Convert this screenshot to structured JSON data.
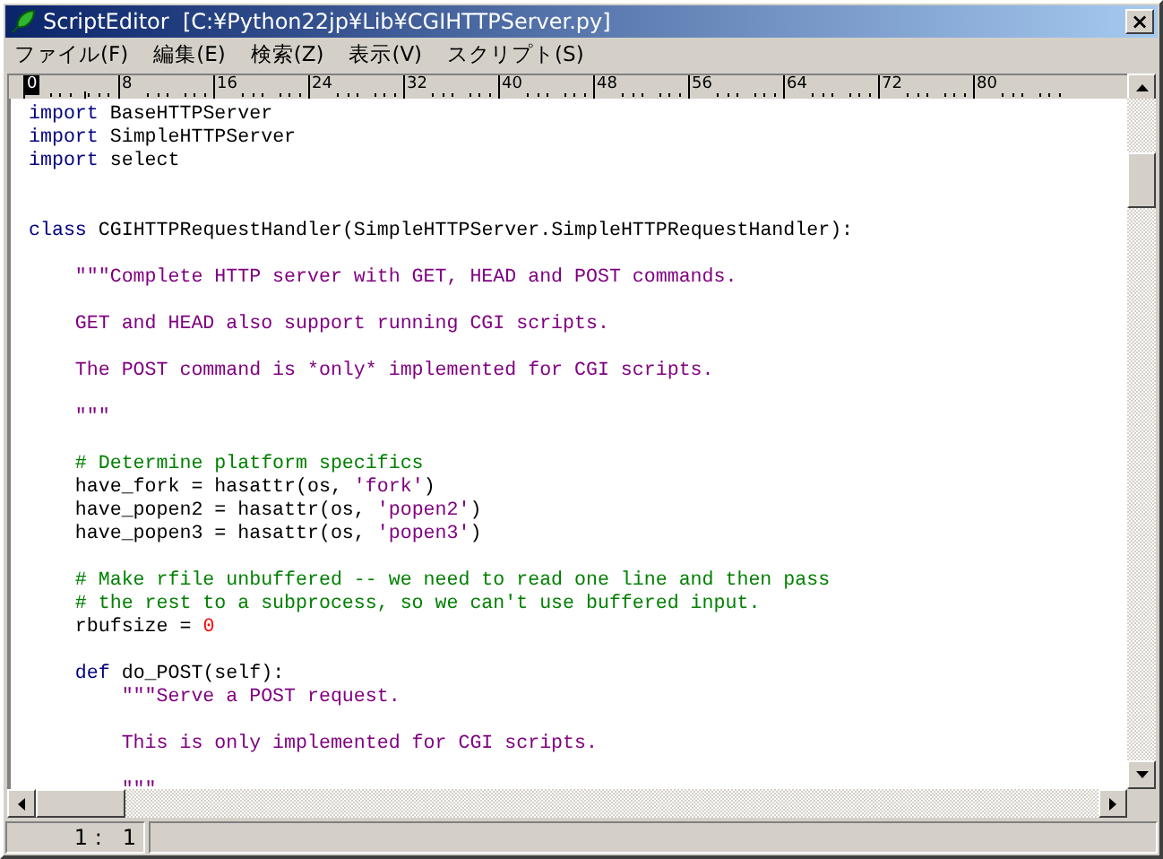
{
  "window": {
    "title": "ScriptEditor  [C:¥Python22jp¥Lib¥CGIHTTPServer.py]",
    "close": "×"
  },
  "menu": [
    {
      "label": "ファイル(F)"
    },
    {
      "label": "編集(E)"
    },
    {
      "label": "検索(Z)"
    },
    {
      "label": "表示(V)"
    },
    {
      "label": "スクリプト(S)"
    }
  ],
  "ruler": [
    {
      "label": "0",
      "selected": true
    },
    {
      "label": "8",
      "selected": false
    },
    {
      "label": "16",
      "selected": false
    },
    {
      "label": "24",
      "selected": false
    },
    {
      "label": "32",
      "selected": false
    },
    {
      "label": "40",
      "selected": false
    },
    {
      "label": "48",
      "selected": false
    },
    {
      "label": "56",
      "selected": false
    },
    {
      "label": "64",
      "selected": false
    },
    {
      "label": "72",
      "selected": false
    },
    {
      "label": "80",
      "selected": false
    }
  ],
  "lines": [
    {
      "kind": "code",
      "tokens": [
        {
          "kind": "keyword",
          "text": "import"
        },
        {
          "kind": "plain",
          "text": " BaseHTTPServer"
        }
      ]
    },
    {
      "kind": "code",
      "tokens": [
        {
          "kind": "keyword",
          "text": "import"
        },
        {
          "kind": "plain",
          "text": " SimpleHTTPServer"
        }
      ]
    },
    {
      "kind": "code",
      "tokens": [
        {
          "kind": "keyword",
          "text": "import"
        },
        {
          "kind": "plain",
          "text": " select"
        }
      ]
    },
    {
      "kind": "blank"
    },
    {
      "kind": "blank"
    },
    {
      "kind": "code",
      "tokens": [
        {
          "kind": "keyword",
          "text": "class"
        },
        {
          "kind": "plain",
          "text": " CGIHTTPRequestHandler(SimpleHTTPServer.SimpleHTTPRequestHandler):"
        }
      ],
      "children": [
        {
          "kind": "blank"
        },
        {
          "kind": "code",
          "tokens": [
            {
              "kind": "string",
              "text": "\"\"\"Complete HTTP server with GET, HEAD and POST commands."
            }
          ]
        },
        {
          "kind": "blank"
        },
        {
          "kind": "code",
          "tokens": [
            {
              "kind": "string",
              "text": "GET and HEAD also support running CGI scripts."
            }
          ]
        },
        {
          "kind": "blank"
        },
        {
          "kind": "code",
          "tokens": [
            {
              "kind": "string",
              "text": "The POST command is *only* implemented for CGI scripts."
            }
          ]
        },
        {
          "kind": "blank"
        },
        {
          "kind": "code",
          "tokens": [
            {
              "kind": "string",
              "text": "\"\"\""
            }
          ]
        },
        {
          "kind": "blank"
        },
        {
          "kind": "code",
          "tokens": [
            {
              "kind": "comment",
              "text": "# Determine platform specifics"
            }
          ]
        },
        {
          "kind": "code",
          "tokens": [
            {
              "kind": "plain",
              "text": "have_fork = hasattr(os, "
            },
            {
              "kind": "string",
              "text": "'fork'"
            },
            {
              "kind": "plain",
              "text": ")"
            }
          ]
        },
        {
          "kind": "code",
          "tokens": [
            {
              "kind": "plain",
              "text": "have_popen2 = hasattr(os, "
            },
            {
              "kind": "string",
              "text": "'popen2'"
            },
            {
              "kind": "plain",
              "text": ")"
            }
          ]
        },
        {
          "kind": "code",
          "tokens": [
            {
              "kind": "plain",
              "text": "have_popen3 = hasattr(os, "
            },
            {
              "kind": "string",
              "text": "'popen3'"
            },
            {
              "kind": "plain",
              "text": ")"
            }
          ]
        },
        {
          "kind": "blank"
        },
        {
          "kind": "code",
          "tokens": [
            {
              "kind": "comment",
              "text": "# Make rfile unbuffered -- we need to read one line and then pass"
            }
          ]
        },
        {
          "kind": "code",
          "tokens": [
            {
              "kind": "comment",
              "text": "# the rest to a subprocess, so we can't use buffered input."
            }
          ]
        },
        {
          "kind": "code",
          "tokens": [
            {
              "kind": "plain",
              "text": "rbufsize = "
            },
            {
              "kind": "number",
              "text": "0"
            }
          ]
        },
        {
          "kind": "blank"
        },
        {
          "kind": "code",
          "tokens": [
            {
              "kind": "keyword",
              "text": "def"
            },
            {
              "kind": "plain",
              "text": " do_POST(self):"
            }
          ],
          "children": [
            {
              "kind": "code",
              "tokens": [
                {
                  "kind": "string",
                  "text": "\"\"\"Serve a POST request."
                }
              ]
            },
            {
              "kind": "blank"
            },
            {
              "kind": "code",
              "tokens": [
                {
                  "kind": "string",
                  "text": "This is only implemented for CGI scripts."
                }
              ]
            },
            {
              "kind": "blank"
            },
            {
              "kind": "code",
              "tokens": [
                {
                  "kind": "string",
                  "text": "\"\"\""
                }
              ]
            }
          ]
        }
      ]
    }
  ],
  "status": {
    "position": "1 :   1"
  }
}
